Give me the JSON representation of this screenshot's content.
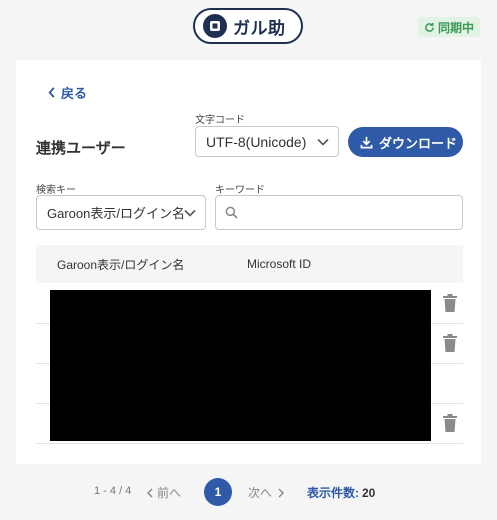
{
  "header": {
    "logo_text": "ガル助",
    "sync_status": "同期中"
  },
  "nav": {
    "back_label": "戻る"
  },
  "page": {
    "title": "連携ユーザー"
  },
  "encoding": {
    "label": "文字コード",
    "selected": "UTF-8(Unicode)"
  },
  "download": {
    "label": "ダウンロード"
  },
  "search": {
    "key_label": "検索キー",
    "key_selected": "Garoon表示/ログイン名",
    "keyword_label": "キーワード",
    "keyword_value": "",
    "keyword_placeholder": ""
  },
  "table": {
    "columns": [
      "Garoon表示/ログイン名",
      "Microsoft ID"
    ],
    "rows": [
      {
        "has_delete": true
      },
      {
        "has_delete": true
      },
      {
        "has_delete": false
      },
      {
        "has_delete": true
      }
    ]
  },
  "pagination": {
    "range": "1 - 4 / 4",
    "prev_label": "前へ",
    "current_page": "1",
    "next_label": "次へ",
    "per_page_label": "表示件数:",
    "per_page_value": "20"
  },
  "colors": {
    "primary": "#2f5aa8",
    "sync_green": "#3a9a55",
    "logo_navy": "#1e2f52"
  },
  "icons": {
    "logo": "logo-mark-icon",
    "sync": "sync-icon",
    "back": "chevron-left-icon",
    "dropdown": "chevron-down-icon",
    "download": "download-icon",
    "search": "search-icon",
    "delete": "trash-icon",
    "prev": "chevron-left-icon",
    "next": "chevron-right-icon"
  }
}
